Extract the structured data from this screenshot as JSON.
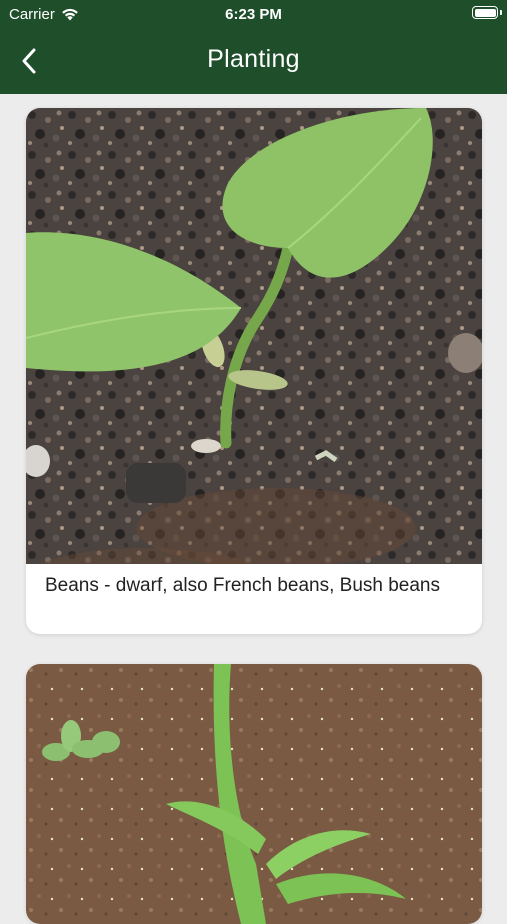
{
  "status_bar": {
    "carrier": "Carrier",
    "time": "6:23 PM"
  },
  "nav": {
    "title": "Planting",
    "back_icon": "chevron-left-icon"
  },
  "cards": [
    {
      "caption": "Beans - dwarf, also French beans, Bush beans",
      "image": "bean-seedling-photo"
    },
    {
      "caption": "",
      "image": "corn-seedling-photo"
    }
  ],
  "colors": {
    "header_bg": "#1f4e2b",
    "page_bg": "#ececec",
    "card_bg": "#ffffff"
  }
}
